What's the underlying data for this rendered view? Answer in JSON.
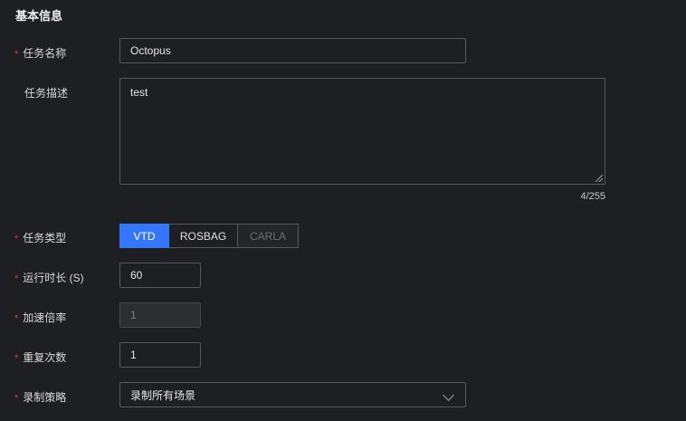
{
  "section": {
    "title": "基本信息"
  },
  "fields": {
    "task_name": {
      "label": "任务名称",
      "value": "Octopus",
      "required": true
    },
    "task_desc": {
      "label": "任务描述",
      "value": "test",
      "counter": "4/255",
      "required": false
    },
    "task_type": {
      "label": "任务类型",
      "required": true,
      "options": [
        {
          "label": "VTD",
          "state": "selected"
        },
        {
          "label": "ROSBAG",
          "state": "normal"
        },
        {
          "label": "CARLA",
          "state": "disabled"
        }
      ]
    },
    "duration": {
      "label": "运行时长 (S)",
      "value": "60",
      "required": true
    },
    "speed": {
      "label": "加速倍率",
      "value": "1",
      "required": true,
      "disabled": true
    },
    "repeat": {
      "label": "重复次数",
      "value": "1",
      "required": true
    },
    "record_policy": {
      "label": "录制策略",
      "value": "录制所有场景",
      "required": true
    }
  },
  "required_mark": "*",
  "colors": {
    "background": "#1d1f22",
    "accent": "#3377ff",
    "required": "#e4393c",
    "border": "#55585e"
  }
}
